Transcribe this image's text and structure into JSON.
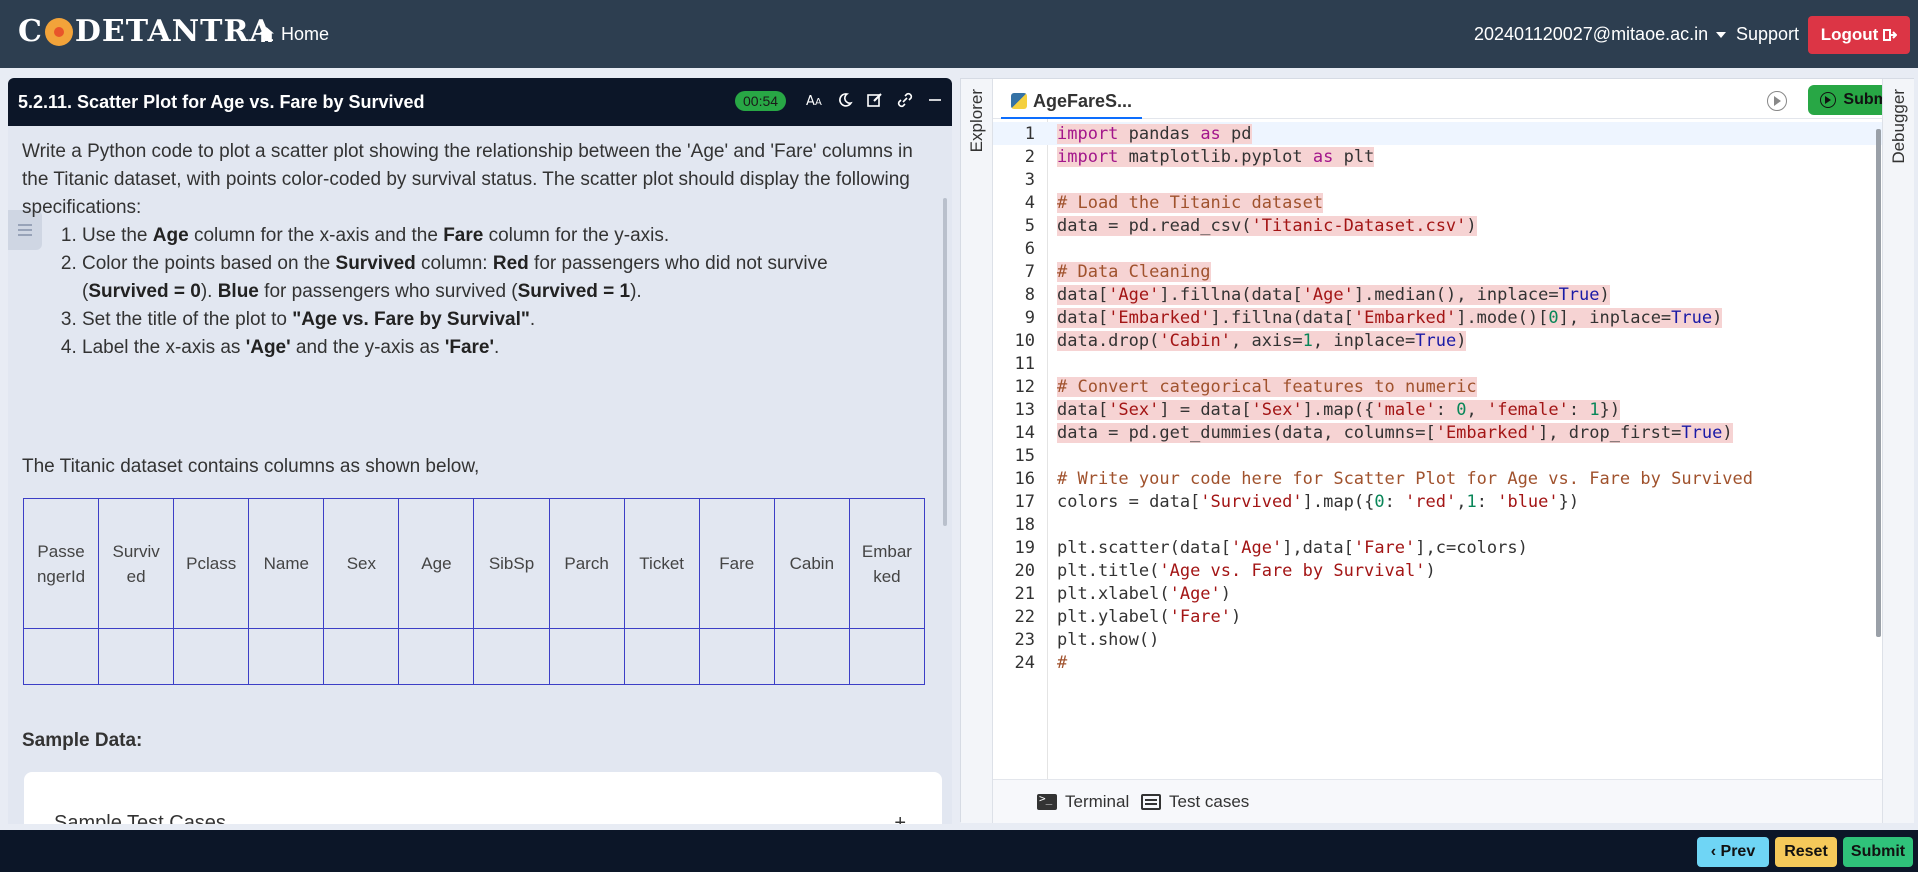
{
  "nav": {
    "logo_text": "CODETANTRA",
    "home": "Home",
    "user_email": "202401120027@mitaoe.ac.in",
    "support": "Support",
    "logout": "Logout"
  },
  "question": {
    "title": "5.2.11. Scatter Plot for Age vs. Fare by Survived",
    "timer": "00:54",
    "intro": "Write a Python code to plot a scatter plot showing the relationship between the 'Age' and 'Fare' columns in the Titanic dataset, with points color-coded by survival status. The scatter plot should display the following specifications:",
    "steps": [
      {
        "pre": "Use the ",
        "b1": "Age",
        "mid": " column for the x-axis and the ",
        "b2": "Fare",
        "post": " column for the y-axis."
      },
      {
        "pre": "Color the points based on the ",
        "b1": "Survived",
        "mid": " column: ",
        "b2": "Red",
        "post": " for passengers who did not survive"
      },
      {
        "pre": "Set the title of the plot to ",
        "b1": "\"Age vs. Fare by Survival\"",
        "mid": ".",
        "b2": "",
        "post": ""
      },
      {
        "pre": "Label the x-axis as ",
        "b1": "'Age'",
        "mid": " and the y-axis as ",
        "b2": "'Fare'",
        "post": "."
      }
    ],
    "step2_cont": {
      "open": "(",
      "b1": "Survived = 0",
      "mid1": "). ",
      "b2": "Blue",
      "mid2": " for passengers who survived (",
      "b3": "Survived = 1",
      "close": ")."
    },
    "dataset_line": "The Titanic dataset contains columns as shown below,",
    "columns": [
      "PassengerId",
      "Survived",
      "Pclass",
      "Name",
      "Sex",
      "Age",
      "SibSp",
      "Parch",
      "Ticket",
      "Fare",
      "Cabin",
      "Embarked"
    ],
    "sample_data_label": "Sample Data:",
    "sample_test_cases": "Sample Test Cases",
    "expand": "+"
  },
  "editor": {
    "explorer": "Explorer",
    "debugger": "Debugger",
    "file_tab": "AgeFareS...",
    "submit": "Submit",
    "terminal": "Terminal",
    "test_cases": "Test cases",
    "lines": [
      {
        "n": "1",
        "html": "<span class=\"kw\">import</span> pandas <span class=\"kw\">as</span> pd",
        "hl": true
      },
      {
        "n": "2",
        "html": "<span class=\"kw\">import</span> matplotlib.pyplot <span class=\"kw\">as</span> plt",
        "hl": true
      },
      {
        "n": "3",
        "html": "",
        "hl": false
      },
      {
        "n": "4",
        "html": "<span class=\"cm\"># Load the Titanic dataset</span>",
        "hl": true
      },
      {
        "n": "5",
        "html": "data = pd.read_csv(<span class=\"str\">'Titanic-Dataset.csv'</span>)",
        "hl": true
      },
      {
        "n": "6",
        "html": "",
        "hl": false
      },
      {
        "n": "7",
        "html": "<span class=\"cm\"># Data Cleaning</span>",
        "hl": true
      },
      {
        "n": "8",
        "html": "data[<span class=\"str\">'Age'</span>].fillna(data[<span class=\"str\">'Age'</span>].median(), inplace=<span class=\"bl\">True</span>)",
        "hl": true
      },
      {
        "n": "9",
        "html": "data[<span class=\"str\">'Embarked'</span>].fillna(data[<span class=\"str\">'Embarked'</span>].mode()[<span class=\"num\">0</span>], inplace=<span class=\"bl\">True</span>)",
        "hl": true
      },
      {
        "n": "10",
        "html": "data.drop(<span class=\"str\">'Cabin'</span>, axis=<span class=\"num\">1</span>, inplace=<span class=\"bl\">True</span>)",
        "hl": true
      },
      {
        "n": "11",
        "html": "",
        "hl": false
      },
      {
        "n": "12",
        "html": "<span class=\"cm\"># Convert categorical features to numeric</span>",
        "hl": true
      },
      {
        "n": "13",
        "html": "data[<span class=\"str\">'Sex'</span>] = data[<span class=\"str\">'Sex'</span>].map({<span class=\"str\">'male'</span>: <span class=\"num\">0</span>, <span class=\"str\">'female'</span>: <span class=\"num\">1</span>})",
        "hl": true
      },
      {
        "n": "14",
        "html": "data = pd.get_dummies(data, columns=[<span class=\"str\">'Embarked'</span>], drop_first=<span class=\"bl\">True</span>)",
        "hl": true
      },
      {
        "n": "15",
        "html": "",
        "hl": false
      },
      {
        "n": "16",
        "html": "<span class=\"cm\"># Write your code here for Scatter Plot for Age vs. Fare by Survived</span>",
        "hl": false
      },
      {
        "n": "17",
        "html": "colors = data[<span class=\"str\">'Survived'</span>].map({<span class=\"num\">0</span>: <span class=\"str\">'red'</span>,<span class=\"num\">1</span>: <span class=\"str\">'blue'</span>})",
        "hl": false
      },
      {
        "n": "18",
        "html": "",
        "hl": false
      },
      {
        "n": "19",
        "html": "plt.scatter(data[<span class=\"str\">'Age'</span>],data[<span class=\"str\">'Fare'</span>],c=colors)",
        "hl": false
      },
      {
        "n": "20",
        "html": "plt.title(<span class=\"str\">'Age vs. Fare by Survival'</span>)",
        "hl": false
      },
      {
        "n": "21",
        "html": "plt.xlabel(<span class=\"str\">'Age'</span>)",
        "hl": false
      },
      {
        "n": "22",
        "html": "plt.ylabel(<span class=\"str\">'Fare'</span>)",
        "hl": false
      },
      {
        "n": "23",
        "html": "plt.show()",
        "hl": false
      },
      {
        "n": "24",
        "html": "<span class=\"cm\">#</span>",
        "hl": false
      }
    ]
  },
  "footer": {
    "prev": "Prev",
    "reset": "Reset",
    "submit": "Submit"
  }
}
